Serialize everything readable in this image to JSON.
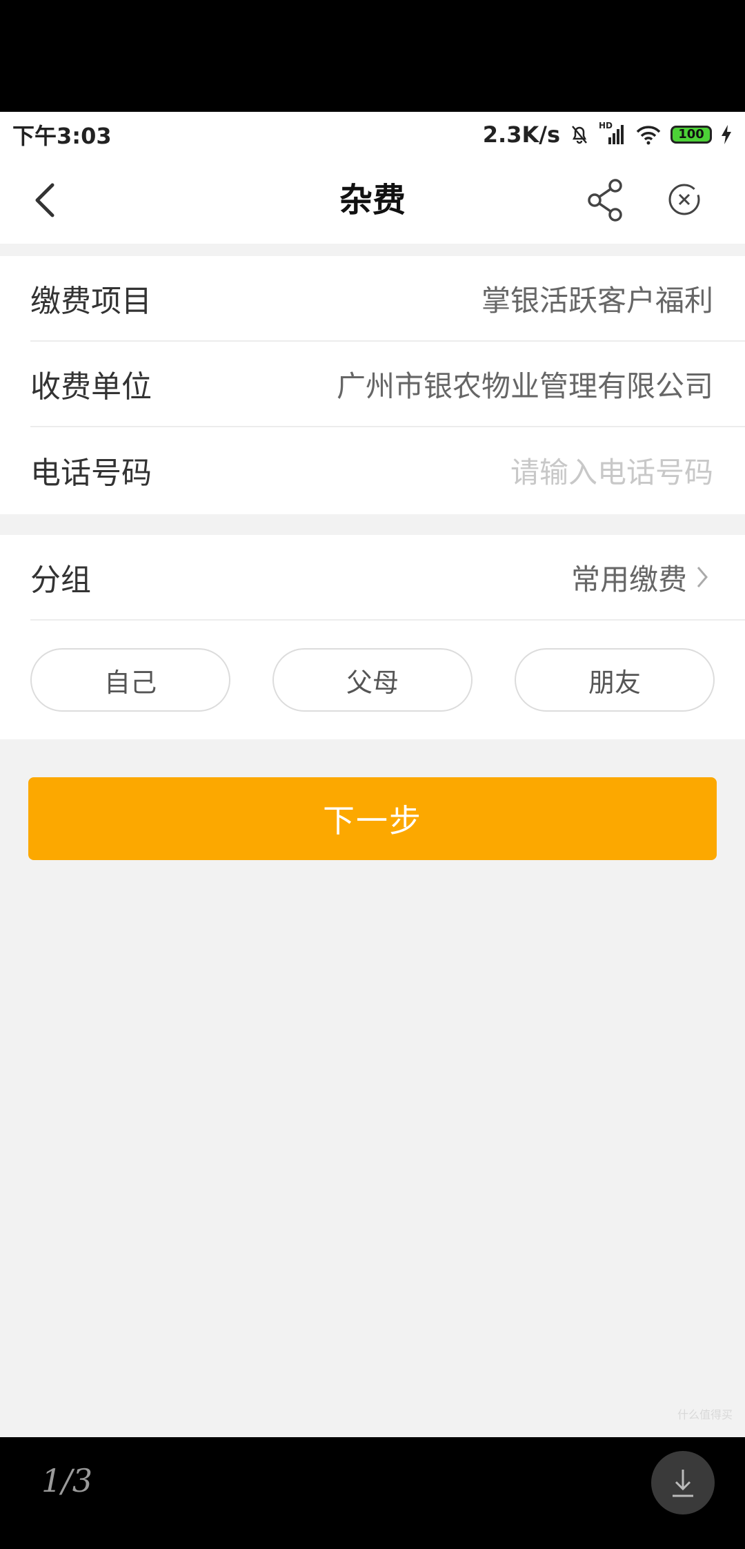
{
  "status_bar": {
    "time": "下午3:03",
    "net_speed": "2.3K/s",
    "signal_label": "HD",
    "battery": "100"
  },
  "nav": {
    "title": "杂费"
  },
  "form": {
    "item_label": "缴费项目",
    "item_value": "掌银活跃客户福利",
    "payee_label": "收费单位",
    "payee_value": "广州市银农物业管理有限公司",
    "phone_label": "电话号码",
    "phone_placeholder": "请输入电话号码"
  },
  "group": {
    "label": "分组",
    "value": "常用缴费",
    "chips": [
      "自己",
      "父母",
      "朋友"
    ]
  },
  "next_button": "下一步",
  "viewer": {
    "page_indicator": "1/3",
    "watermark": "什么值得买"
  },
  "colors": {
    "accent": "#fca800",
    "background": "#f2f2f2",
    "battery_fill": "#4cd137"
  }
}
